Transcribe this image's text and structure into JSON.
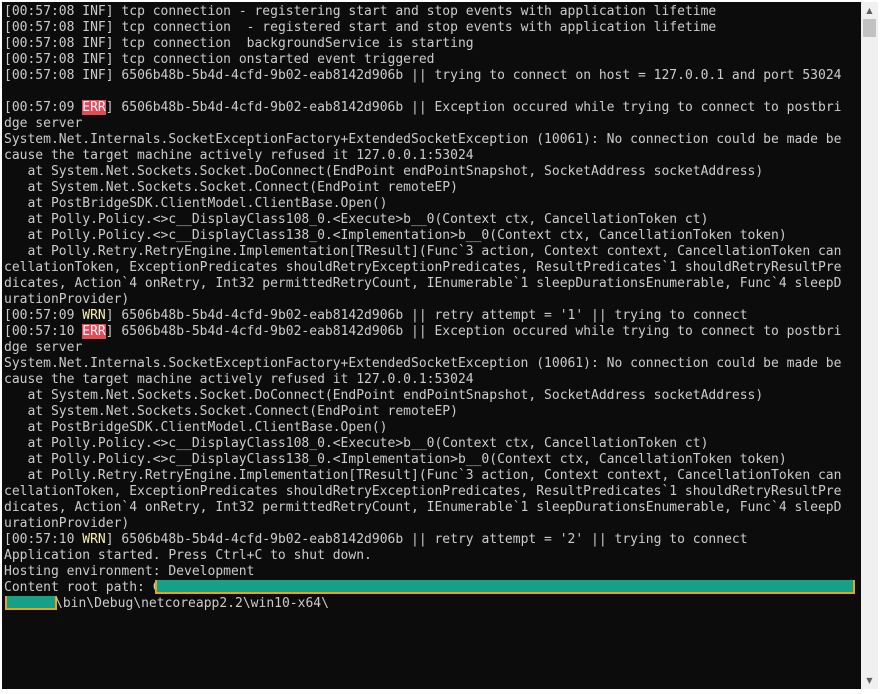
{
  "console": {
    "lines": [
      {
        "ts": "[00:57:08 ",
        "level": "INF",
        "msg": "] tcp connection - registering start and stop events with application lifetime"
      },
      {
        "ts": "[00:57:08 ",
        "level": "INF",
        "msg": "] tcp connection  - registered start and stop events with application lifetime"
      },
      {
        "ts": "[00:57:08 ",
        "level": "INF",
        "msg": "] tcp connection  backgroundService is starting"
      },
      {
        "ts": "[00:57:08 ",
        "level": "INF",
        "msg": "] tcp connection onstarted event triggered"
      },
      {
        "ts": "[00:57:08 ",
        "level": "INF",
        "msg": "] 6506b48b-5b4d-4cfd-9b02-eab8142d906b || trying to connect on host = 127.0.0.1 and port 53024"
      },
      {
        "text": ""
      },
      {
        "ts": "[00:57:09 ",
        "level": "ERR",
        "msg": "] 6506b48b-5b4d-4cfd-9b02-eab8142d906b || Exception occured while trying to connect to postbri"
      },
      {
        "text": "dge server"
      },
      {
        "text": "System.Net.Internals.SocketExceptionFactory+ExtendedSocketException (10061): No connection could be made be"
      },
      {
        "text": "cause the target machine actively refused it 127.0.0.1:53024"
      },
      {
        "text": "   at System.Net.Sockets.Socket.DoConnect(EndPoint endPointSnapshot, SocketAddress socketAddress)"
      },
      {
        "text": "   at System.Net.Sockets.Socket.Connect(EndPoint remoteEP)"
      },
      {
        "text": "   at PostBridgeSDK.ClientModel.ClientBase.Open()"
      },
      {
        "text": "   at Polly.Policy.<>c__DisplayClass108_0.<Execute>b__0(Context ctx, CancellationToken ct)"
      },
      {
        "text": "   at Polly.Policy.<>c__DisplayClass138_0.<Implementation>b__0(Context ctx, CancellationToken token)"
      },
      {
        "text": "   at Polly.Retry.RetryEngine.Implementation[TResult](Func`3 action, Context context, CancellationToken can"
      },
      {
        "text": "cellationToken, ExceptionPredicates shouldRetryExceptionPredicates, ResultPredicates`1 shouldRetryResultPre"
      },
      {
        "text": "dicates, Action`4 onRetry, Int32 permittedRetryCount, IEnumerable`1 sleepDurationsEnumerable, Func`4 sleepD"
      },
      {
        "text": "urationProvider)"
      },
      {
        "ts": "[00:57:09 ",
        "level": "WRN",
        "msg": "] 6506b48b-5b4d-4cfd-9b02-eab8142d906b || retry attempt = '1' || trying to connect"
      },
      {
        "ts": "[00:57:10 ",
        "level": "ERR",
        "msg": "] 6506b48b-5b4d-4cfd-9b02-eab8142d906b || Exception occured while trying to connect to postbri"
      },
      {
        "text": "dge server"
      },
      {
        "text": "System.Net.Internals.SocketExceptionFactory+ExtendedSocketException (10061): No connection could be made be"
      },
      {
        "text": "cause the target machine actively refused it 127.0.0.1:53024"
      },
      {
        "text": "   at System.Net.Sockets.Socket.DoConnect(EndPoint endPointSnapshot, SocketAddress socketAddress)"
      },
      {
        "text": "   at System.Net.Sockets.Socket.Connect(EndPoint remoteEP)"
      },
      {
        "text": "   at PostBridgeSDK.ClientModel.ClientBase.Open()"
      },
      {
        "text": "   at Polly.Policy.<>c__DisplayClass108_0.<Execute>b__0(Context ctx, CancellationToken ct)"
      },
      {
        "text": "   at Polly.Policy.<>c__DisplayClass138_0.<Implementation>b__0(Context ctx, CancellationToken token)"
      },
      {
        "text": "   at Polly.Retry.RetryEngine.Implementation[TResult](Func`3 action, Context context, CancellationToken can"
      },
      {
        "text": "cellationToken, ExceptionPredicates shouldRetryExceptionPredicates, ResultPredicates`1 shouldRetryResultPre"
      },
      {
        "text": "dicates, Action`4 onRetry, Int32 permittedRetryCount, IEnumerable`1 sleepDurationsEnumerable, Func`4 sleepD"
      },
      {
        "text": "urationProvider)"
      },
      {
        "ts": "[00:57:10 ",
        "level": "WRN",
        "msg": "] 6506b48b-5b4d-4cfd-9b02-eab8142d906b || retry attempt = '2' || trying to connect"
      },
      {
        "text": "Application started. Press Ctrl+C to shut down."
      },
      {
        "text": "Hosting environment: Development"
      },
      {
        "text": "Content root path: C",
        "redacted": true
      },
      {
        "redactedPrefix": true,
        "text": "\\bin\\Debug\\netcoreapp2.2\\win10-x64\\"
      }
    ]
  },
  "colors": {
    "background": "#0c0c0c",
    "text": "#cccccc",
    "error_badge": "#e74856",
    "warning": "#f9f1a5",
    "redaction_fill": "#16a085",
    "redaction_border": "#e8a317"
  },
  "scrollbar": {
    "up_icon": "triangle-up",
    "down_icon": "triangle-down"
  }
}
